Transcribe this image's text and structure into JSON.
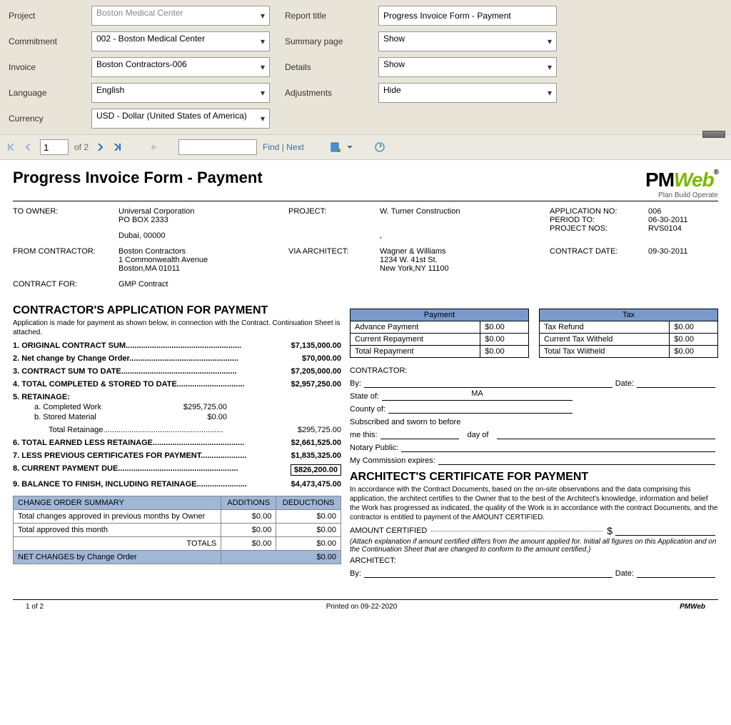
{
  "filters": {
    "labels": {
      "project": "Project",
      "commitment": "Commitment",
      "invoice": "Invoice",
      "language": "Language",
      "currency": "Currency",
      "report_title": "Report title",
      "summary_page": "Summary page",
      "details": "Details",
      "adjustments": "Adjustments"
    },
    "values": {
      "project": "Boston Medical Center",
      "commitment": "002 - Boston Medical Center",
      "invoice": "Boston Contractors-006",
      "language": "English",
      "currency": "USD - Dollar (United States of America)",
      "report_title": "Progress Invoice Form - Payment",
      "summary_page": "Show",
      "details": "Show",
      "adjustments": "Hide"
    }
  },
  "toolbar": {
    "page_current": "1",
    "page_of": "of 2",
    "find_label": "Find",
    "next_label": "Next"
  },
  "report": {
    "title": "Progress Invoice Form - Payment",
    "logo": {
      "pm": "PM",
      "w": "Web",
      "reg": "®",
      "tag": "Plan  Build  Operate"
    },
    "meta": {
      "to_owner_label": "TO OWNER:",
      "to_owner_name": "Universal Corporation",
      "to_owner_addr1": "PO BOX 2333",
      "to_owner_addr2": "Dubai, 00000",
      "project_label": "PROJECT:",
      "project_val": "W. Turner Construction",
      "app_no_label": "APPLICATION NO:",
      "app_no": "006",
      "period_label": "PERIOD TO:",
      "period": "06-30-2011",
      "proj_nos_label": "PROJECT NOS:",
      "proj_nos": "RVS0104",
      "from_label": "FROM CONTRACTOR:",
      "from_name": "Boston Contractors",
      "from_addr1": "1 Commonwealth Avenue",
      "from_addr2": "Boston,MA 01011",
      "via_label": "VIA ARCHITECT:",
      "via_name": "Wagner & Williams",
      "via_addr1": "1234 W. 41st St.",
      "via_addr2": "New York,NY 11100",
      "contract_date_label": "CONTRACT DATE:",
      "contract_date": "09-30-2011",
      "contract_for_label": "CONTRACT FOR:",
      "contract_for": "GMP Contract"
    },
    "app_section": {
      "title": "CONTRACTOR'S APPLICATION FOR PAYMENT",
      "sub": "Application is made for payment as shown below, in connection with the Contract. Continuation Sheet is attached.",
      "lines": {
        "l1": "1. ORIGINAL CONTRACT SUM.....................................................",
        "v1": "$7,135,000.00",
        "l2": "2. Net change by Change Order..................................................",
        "v2": "$70,000.00",
        "l3": "3. CONTRACT SUM TO DATE.....................................................",
        "v3": "$7,205,000.00",
        "l4": "4. TOTAL COMPLETED & STORED TO DATE...............................",
        "v4": "$2,957,250.00",
        "l5": "5. RETAINAGE:",
        "l5a_label": "a.   Completed Work",
        "l5a_val": "$295,725.00",
        "l5b_label": "b.   Stored Material",
        "l5b_val": "$0.00",
        "l5t_label": "Total Retainage.......................................................",
        "l5t_val": "$295,725.00",
        "l6": "6. TOTAL EARNED LESS RETAINAGE..........................................",
        "v6": "$2,661,525.00",
        "l7": "7. LESS PREVIOUS CERTIFICATES FOR PAYMENT.....................",
        "v7": "$1,835,325.00",
        "l8": "8. CURRENT PAYMENT DUE.......................................................",
        "v8": "$826,200.00",
        "l9": "9. BALANCE TO FINISH, INCLUDING RETAINAGE.......................",
        "v9": "$4,473,475.00"
      },
      "co_table": {
        "h1": "CHANGE ORDER SUMMARY",
        "h2": "ADDITIONS",
        "h3": "DEDUCTIONS",
        "r1_label": "Total changes approved in previous months by Owner",
        "r1_add": "$0.00",
        "r1_ded": "$0.00",
        "r2_label": "Total approved this month",
        "r2_add": "$0.00",
        "r2_ded": "$0.00",
        "r3_label": "TOTALS",
        "r3_add": "$0.00",
        "r3_ded": "$0.00",
        "r4_label": "NET CHANGES by Change Order",
        "r4_val": "$0.00"
      }
    },
    "payment_table": {
      "title": "Payment",
      "r1l": "Advance Payment",
      "r1v": "$0.00",
      "r2l": "Current Repayment",
      "r2v": "$0.00",
      "r3l": "Total Repayment",
      "r3v": "$0.00"
    },
    "tax_table": {
      "title": "Tax",
      "r1l": "Tax Refund",
      "r1v": "$0.00",
      "r2l": "Current Tax Witheld",
      "r2v": "$0.00",
      "r3l": "Total Tax Wiitheld",
      "r3v": "$0.00"
    },
    "sig": {
      "contractor": "CONTRACTOR:",
      "by": "By:",
      "date": "Date:",
      "state_of": "State of:",
      "state_val": "MA",
      "county_of": "County of:",
      "sworn": "Subscribed and sworn to before",
      "me_this": "me this:",
      "day_of": "day of",
      "notary": "Notary Public:",
      "commission": "My Commission expires:"
    },
    "arch": {
      "title": "ARCHITECT'S CERTIFICATE FOR PAYMENT",
      "text": "In accordance with the Contract Documents, based on the on-site observations and the data comprising this application, the architect certifies to the Owner that to the best of the Architect's knowledge, information and belief the Work has progressed as indicated, the quality of the Work is in accordance with the contract Documents, and the contractor is entitled to payment of the AMOUNT CERTIFIED.",
      "amount_label": "AMOUNT CERTIFIED",
      "dollar": "$",
      "note": "(Attach explanation if amount certified differs from the amount applied for. Initial all figures on this Application and on the Continuation Sheet that are changed to conform to the amount certified.)",
      "architect": "ARCHITECT:",
      "by": "By:",
      "date": "Date:"
    },
    "footer": {
      "page": "1 of 2",
      "printed": "Printed on 09-22-2020",
      "brand": "PMWeb"
    }
  }
}
